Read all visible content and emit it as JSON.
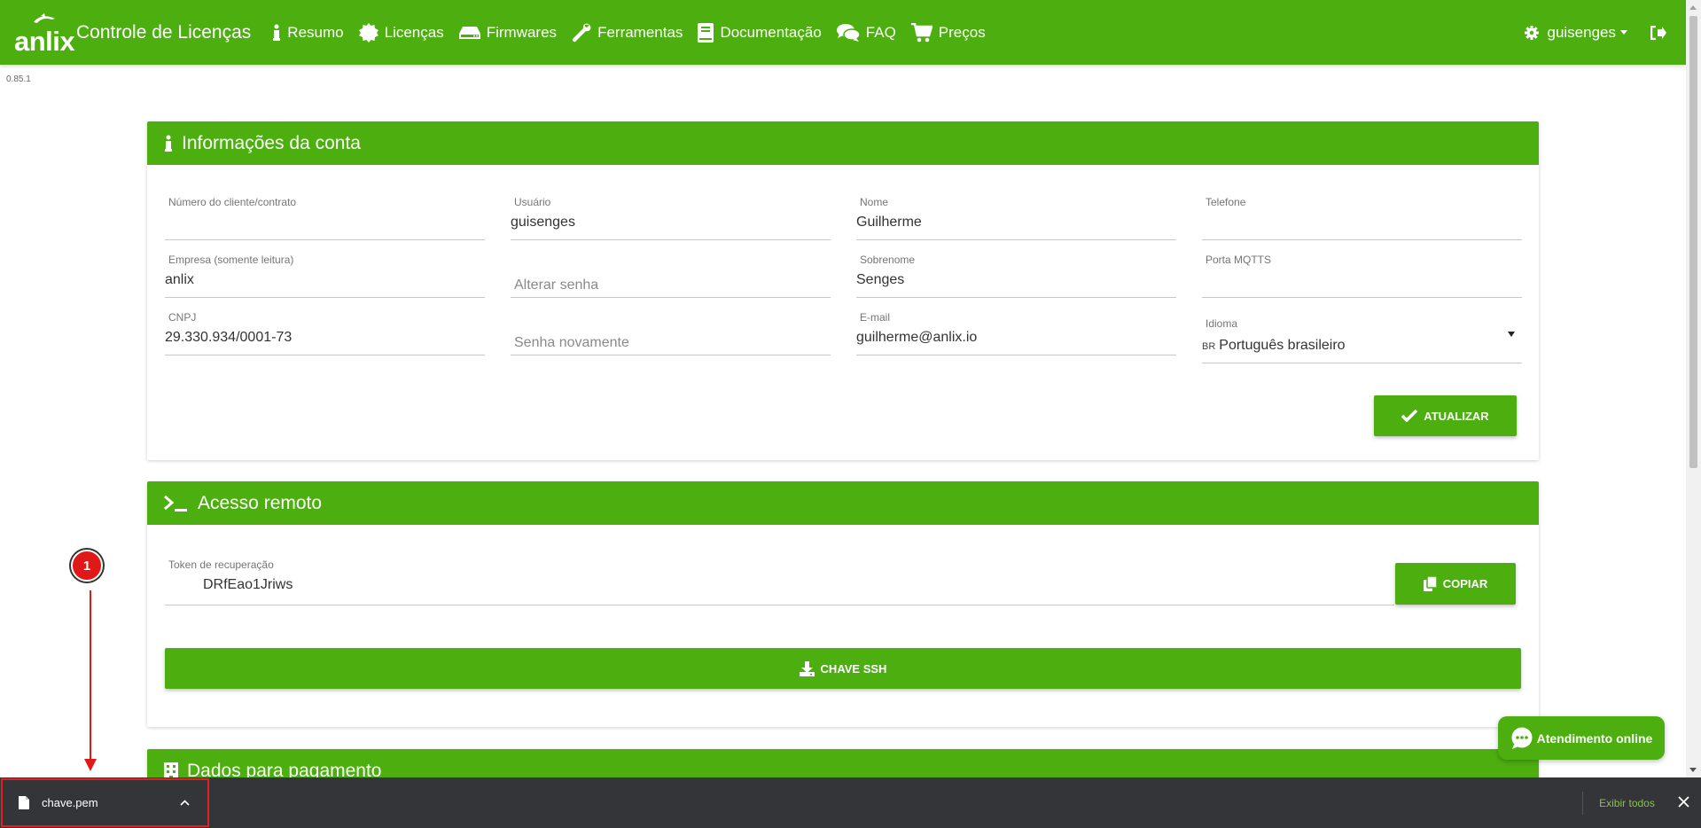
{
  "navbar": {
    "logo_text": "anlix",
    "title": "Controle de Licenças",
    "items": [
      {
        "label": "Resumo",
        "icon": "info-icon"
      },
      {
        "label": "Licenças",
        "icon": "certificate-icon"
      },
      {
        "label": "Firmwares",
        "icon": "hdd-icon"
      },
      {
        "label": "Ferramentas",
        "icon": "wrench-icon"
      },
      {
        "label": "Documentação",
        "icon": "book-icon"
      },
      {
        "label": "FAQ",
        "icon": "comments-icon"
      },
      {
        "label": "Preços",
        "icon": "cart-icon"
      }
    ],
    "user": "guisenges"
  },
  "version": "0.85.1",
  "account": {
    "header": "Informações da conta",
    "fields": {
      "client_number": {
        "label": "Número do cliente/contrato",
        "value": ""
      },
      "user": {
        "label": "Usuário",
        "value": "guisenges"
      },
      "name": {
        "label": "Nome",
        "value": "Guilherme"
      },
      "phone": {
        "label": "Telefone",
        "value": ""
      },
      "company": {
        "label": "Empresa (somente leitura)",
        "value": "anlix"
      },
      "change_password": {
        "placeholder": "Alterar senha"
      },
      "surname": {
        "label": "Sobrenome",
        "value": "Senges"
      },
      "mqtts_port": {
        "label": "Porta MQTTS",
        "value": ""
      },
      "cnpj": {
        "label": "CNPJ",
        "value": "29.330.934/0001-73"
      },
      "password_again": {
        "placeholder": "Senha novamente"
      },
      "email": {
        "label": "E-mail",
        "value": "guilherme@anlix.io"
      },
      "language": {
        "label": "Idioma",
        "flag": "BR",
        "value": "Português brasileiro"
      }
    },
    "update_button": "ATUALIZAR"
  },
  "remote": {
    "header": "Acesso remoto",
    "token_label": "Token de recuperação",
    "token_value": "DRfEao1Jriws",
    "copy_button": "COPIAR",
    "ssh_button": "CHAVE SSH"
  },
  "payment": {
    "header": "Dados para pagamento"
  },
  "chat": {
    "label": "Atendimento online"
  },
  "downloads": {
    "file": "chave.pem",
    "show_all": "Exibir todos"
  },
  "annotation": {
    "number": "1"
  },
  "colors": {
    "brand_green": "#4caf0f",
    "download_bar": "#333538",
    "annotation_red": "#e01818"
  }
}
